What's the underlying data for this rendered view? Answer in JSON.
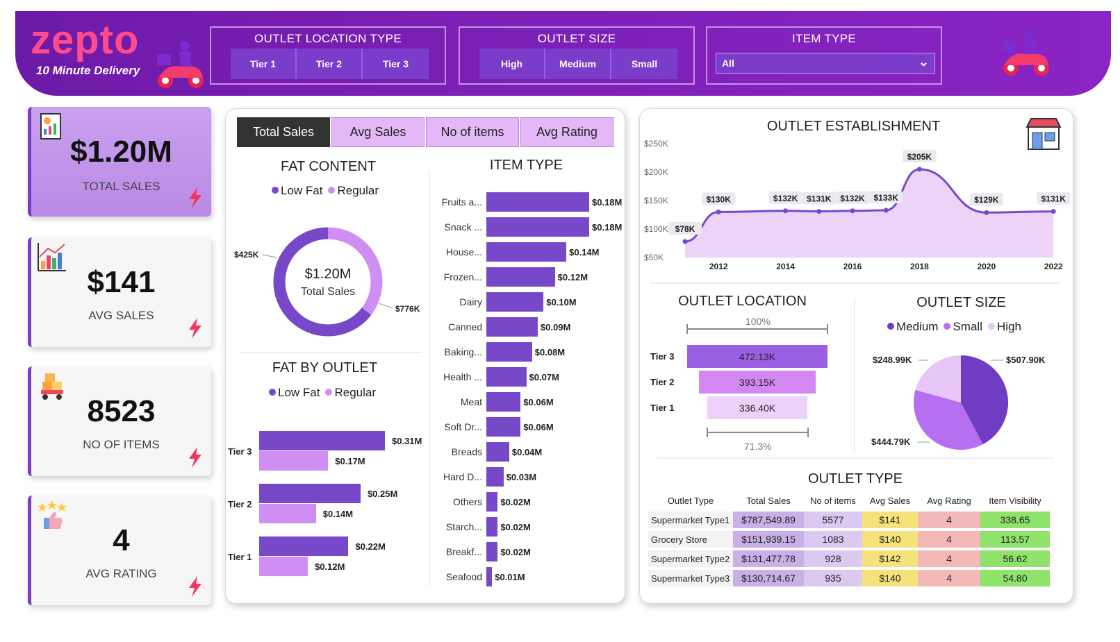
{
  "header": {
    "logo": "zepto",
    "tagline": "10 Minute Delivery",
    "location_slicer": {
      "title": "OUTLET LOCATION TYPE",
      "options": [
        "Tier 1",
        "Tier 2",
        "Tier 3"
      ]
    },
    "size_slicer": {
      "title": "OUTLET SIZE",
      "options": [
        "High",
        "Medium",
        "Small"
      ]
    },
    "item_slicer": {
      "title": "ITEM TYPE",
      "selected": "All"
    }
  },
  "kpis": [
    {
      "value": "$1.20M",
      "label": "TOTAL SALES"
    },
    {
      "value": "$141",
      "label": "AVG SALES"
    },
    {
      "value": "8523",
      "label": "NO OF ITEMS"
    },
    {
      "value": "4",
      "label": "AVG RATING"
    }
  ],
  "tabs": [
    "Total Sales",
    "Avg Sales",
    "No of items",
    "Avg Rating"
  ],
  "fat_content": {
    "title": "FAT CONTENT",
    "legend": [
      "Low Fat",
      "Regular"
    ],
    "center_value": "$1.20M",
    "center_label": "Total Sales",
    "low_fat_label": "$776K",
    "regular_label": "$425K"
  },
  "fat_by_outlet": {
    "title": "FAT BY OUTLET",
    "legend": [
      "Low Fat",
      "Regular"
    ],
    "rows": [
      {
        "tier": "Tier 3",
        "low": "$0.31M",
        "reg": "$0.17M"
      },
      {
        "tier": "Tier 2",
        "low": "$0.25M",
        "reg": "$0.14M"
      },
      {
        "tier": "Tier 1",
        "low": "$0.22M",
        "reg": "$0.12M"
      }
    ]
  },
  "item_type": {
    "title": "ITEM TYPE",
    "rows": [
      {
        "label": "Fruits a...",
        "value": "$0.18M"
      },
      {
        "label": "Snack ...",
        "value": "$0.18M"
      },
      {
        "label": "House...",
        "value": "$0.14M"
      },
      {
        "label": "Frozen...",
        "value": "$0.12M"
      },
      {
        "label": "Dairy",
        "value": "$0.10M"
      },
      {
        "label": "Canned",
        "value": "$0.09M"
      },
      {
        "label": "Baking...",
        "value": "$0.08M"
      },
      {
        "label": "Health ...",
        "value": "$0.07M"
      },
      {
        "label": "Meat",
        "value": "$0.06M"
      },
      {
        "label": "Soft Dr...",
        "value": "$0.06M"
      },
      {
        "label": "Breads",
        "value": "$0.04M"
      },
      {
        "label": "Hard D...",
        "value": "$0.03M"
      },
      {
        "label": "Others",
        "value": "$0.02M"
      },
      {
        "label": "Starch...",
        "value": "$0.02M"
      },
      {
        "label": "Breakf...",
        "value": "$0.02M"
      },
      {
        "label": "Seafood",
        "value": "$0.01M"
      }
    ]
  },
  "outlet_establishment": {
    "title": "OUTLET ESTABLISHMENT",
    "y_ticks": [
      "$250K",
      "$200K",
      "$150K",
      "$100K",
      "$50K"
    ],
    "x_ticks": [
      "2012",
      "2014",
      "2016",
      "2018",
      "2020",
      "2022"
    ],
    "points": [
      {
        "x": 2011,
        "label": "$78K"
      },
      {
        "x": 2012,
        "label": "$130K"
      },
      {
        "x": 2014,
        "label": "$132K"
      },
      {
        "x": 2015,
        "label": "$131K"
      },
      {
        "x": 2016,
        "label": "$132K"
      },
      {
        "x": 2017,
        "label": "$133K"
      },
      {
        "x": 2018,
        "label": "$205K"
      },
      {
        "x": 2020,
        "label": "$129K"
      },
      {
        "x": 2022,
        "label": "$131K"
      }
    ]
  },
  "outlet_location": {
    "title": "OUTLET LOCATION",
    "top_pct": "100%",
    "bottom_pct": "71.3%",
    "rows": [
      {
        "tier": "Tier 3",
        "value": "472.13K"
      },
      {
        "tier": "Tier 2",
        "value": "393.15K"
      },
      {
        "tier": "Tier 1",
        "value": "336.40K"
      }
    ]
  },
  "outlet_size": {
    "title": "OUTLET SIZE",
    "legend": [
      "Medium",
      "Small",
      "High"
    ],
    "labels": {
      "medium": "$507.90K",
      "small": "$444.79K",
      "high": "$248.99K"
    }
  },
  "outlet_type": {
    "title": "OUTLET TYPE",
    "headers": [
      "Outlet Type",
      "Total Sales",
      "No of items",
      "Avg Sales",
      "Avg Rating",
      "Item Visibility"
    ],
    "rows": [
      [
        "Supermarket Type1",
        "$787,549.89",
        "5577",
        "$141",
        "4",
        "338.65"
      ],
      [
        "Grocery Store",
        "$151,939.15",
        "1083",
        "$140",
        "4",
        "113.57"
      ],
      [
        "Supermarket Type2",
        "$131,477.78",
        "928",
        "$142",
        "4",
        "56.62"
      ],
      [
        "Supermarket Type3",
        "$130,714.67",
        "935",
        "$140",
        "4",
        "54.80"
      ]
    ]
  },
  "chart_data": [
    {
      "type": "line",
      "title": "OUTLET ESTABLISHMENT",
      "x": [
        2011,
        2012,
        2014,
        2015,
        2016,
        2017,
        2018,
        2020,
        2022
      ],
      "series": [
        {
          "values": [
            78,
            130,
            132,
            131,
            132,
            133,
            205,
            129,
            131
          ]
        }
      ],
      "ylabel": "",
      "ylim": [
        50,
        250
      ],
      "y_tick_labels": [
        "$250K",
        "$200K",
        "$150K",
        "$100K",
        "$50K"
      ]
    },
    {
      "type": "pie",
      "title": "FAT CONTENT",
      "categories": [
        "Low Fat",
        "Regular"
      ],
      "values": [
        776,
        425
      ]
    },
    {
      "type": "bar",
      "title": "ITEM TYPE",
      "categories": [
        "Fruits a...",
        "Snack ...",
        "House...",
        "Frozen...",
        "Dairy",
        "Canned",
        "Baking...",
        "Health ...",
        "Meat",
        "Soft Dr...",
        "Breads",
        "Hard D...",
        "Others",
        "Starch...",
        "Breakf...",
        "Seafood"
      ],
      "values": [
        0.18,
        0.18,
        0.14,
        0.12,
        0.1,
        0.09,
        0.08,
        0.07,
        0.06,
        0.06,
        0.04,
        0.03,
        0.02,
        0.02,
        0.02,
        0.01
      ]
    },
    {
      "type": "bar",
      "title": "FAT BY OUTLET",
      "categories": [
        "Tier 3",
        "Tier 2",
        "Tier 1"
      ],
      "series": [
        {
          "name": "Low Fat",
          "values": [
            0.31,
            0.25,
            0.22
          ]
        },
        {
          "name": "Regular",
          "values": [
            0.17,
            0.14,
            0.12
          ]
        }
      ]
    },
    {
      "type": "pie",
      "title": "OUTLET SIZE",
      "categories": [
        "Medium",
        "Small",
        "High"
      ],
      "values": [
        507.9,
        444.79,
        248.99
      ]
    },
    {
      "type": "bar",
      "title": "OUTLET LOCATION",
      "categories": [
        "Tier 3",
        "Tier 2",
        "Tier 1"
      ],
      "values": [
        472.13,
        393.15,
        336.4
      ]
    }
  ],
  "colors": {
    "header": "#7b1fb5",
    "accent": "#7749c9",
    "regular": "#cf8ef3",
    "logo": "#ff4b8b",
    "medium": "#6f3cc3",
    "small": "#b66ff0",
    "high": "#e6c7f7"
  }
}
